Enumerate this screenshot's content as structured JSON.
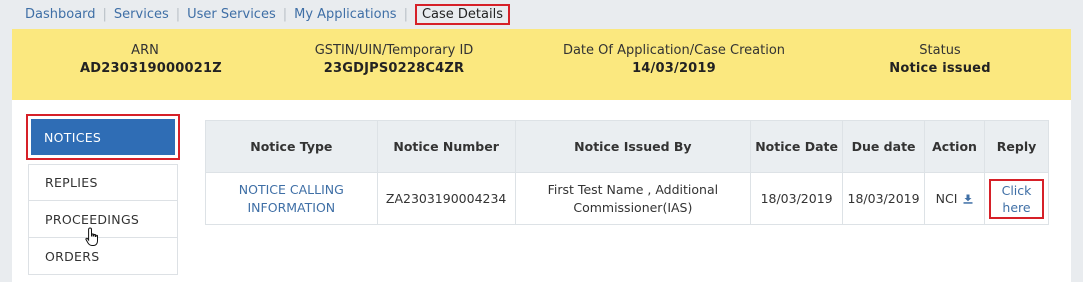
{
  "breadcrumb": {
    "items": [
      "Dashboard",
      "Services",
      "User Services",
      "My Applications"
    ],
    "current": "Case Details"
  },
  "summary": {
    "arn_label": "ARN",
    "arn_value": "AD230319000021Z",
    "gstin_label": "GSTIN/UIN/Temporary ID",
    "gstin_value": "23GDJPS0228C4ZR",
    "date_label": "Date Of Application/Case Creation",
    "date_value": "14/03/2019",
    "status_label": "Status",
    "status_value": "Notice issued"
  },
  "side_tabs": [
    "NOTICES",
    "REPLIES",
    "PROCEEDINGS",
    "ORDERS"
  ],
  "table": {
    "headers": {
      "notice_type": "Notice Type",
      "notice_number": "Notice Number",
      "issued_by": "Notice Issued By",
      "notice_date": "Notice Date",
      "due_date": "Due date",
      "action": "Action",
      "reply": "Reply"
    },
    "row": {
      "notice_type": "NOTICE CALLING INFORMATION",
      "notice_number": "ZA2303190004234",
      "issued_by": "First Test Name , Additional Commissioner(IAS)",
      "notice_date": "18/03/2019",
      "due_date": "18/03/2019",
      "action": "NCI",
      "reply": "Click here"
    }
  },
  "colors": {
    "accent_blue": "#2f6db5",
    "summary_yellow": "#fbe87f",
    "highlight_red": "#d62028",
    "link_blue": "#3f6fa6"
  },
  "icons": {
    "action": "download-icon",
    "cursor": "hand-pointer-icon"
  }
}
